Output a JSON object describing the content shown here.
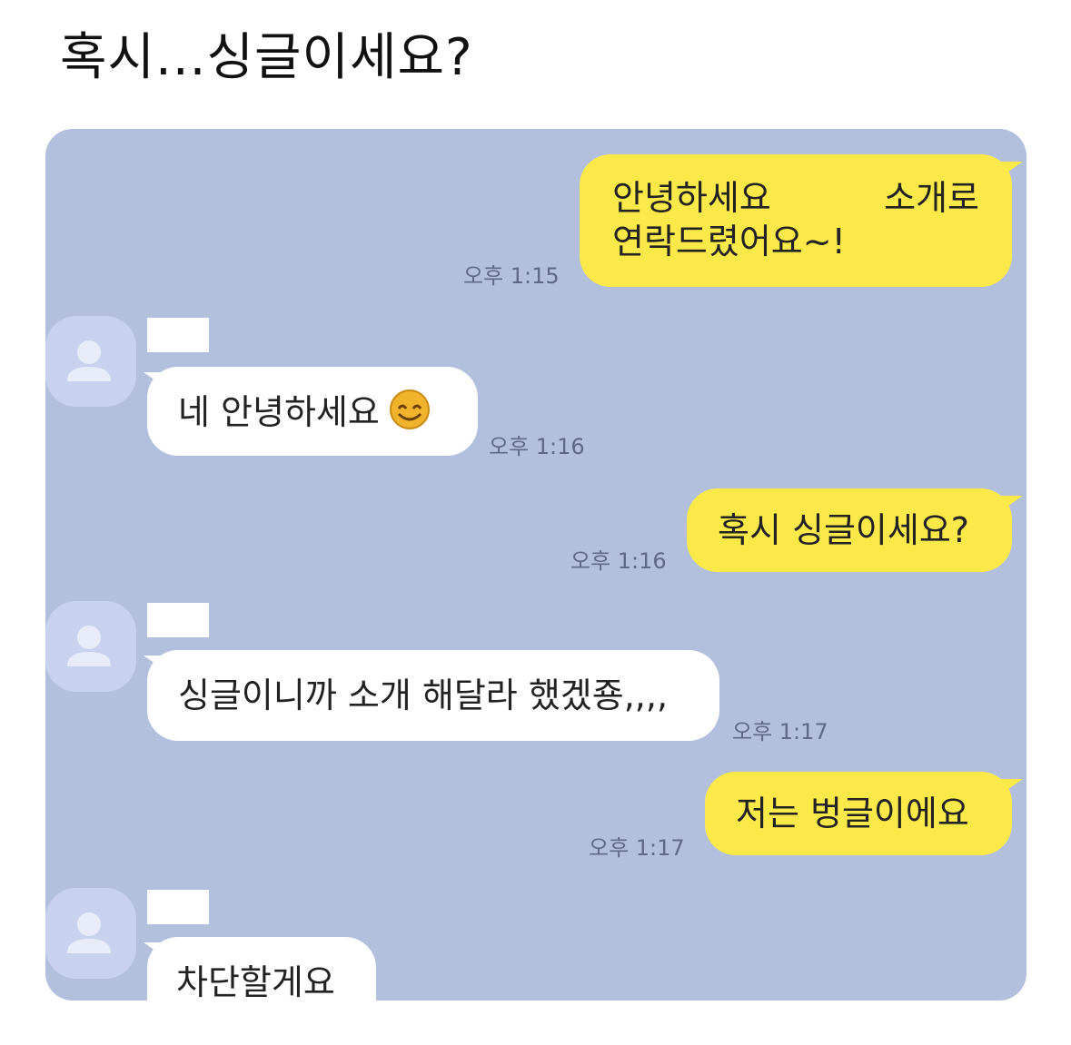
{
  "post": {
    "title": "혹시...싱글이세요?"
  },
  "colors": {
    "chat_background": "#b2c0de",
    "outgoing_bubble": "#fbe94a",
    "incoming_bubble": "#ffffff",
    "avatar": "#c8d2ef",
    "timestamp": "#5f6985"
  },
  "messages": [
    {
      "direction": "outgoing",
      "line1_left": "안녕하세요",
      "line1_right": "소개로",
      "line2": "연락드렸어요~!",
      "time": "오후 1:15"
    },
    {
      "direction": "incoming",
      "text": "네 안녕하세요",
      "emoji": "smiling-face-icon",
      "time": "오후 1:16"
    },
    {
      "direction": "outgoing",
      "text": "혹시 싱글이세요?",
      "time": "오후 1:16"
    },
    {
      "direction": "incoming",
      "text": "싱글이니까 소개 해달라 했겠죵,,,,",
      "time": "오후 1:17"
    },
    {
      "direction": "outgoing",
      "text": "저는 벙글이에요",
      "time": "오후 1:17"
    },
    {
      "direction": "incoming",
      "text": "차단할게요",
      "time": ""
    }
  ]
}
